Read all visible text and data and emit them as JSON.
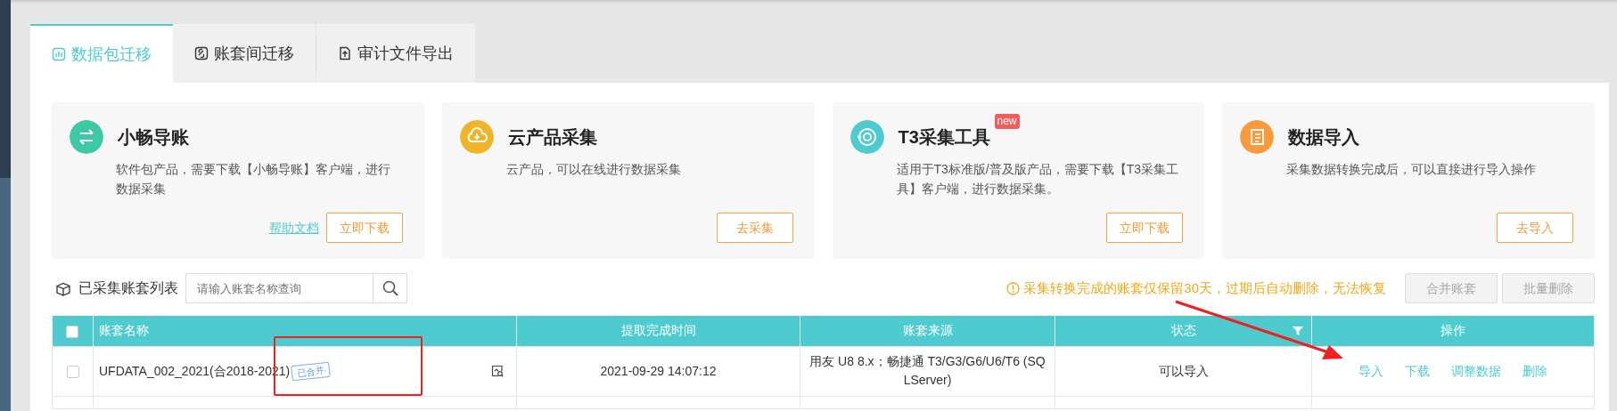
{
  "tabs": [
    {
      "label": "数据包迁移",
      "selected": true
    },
    {
      "label": "账套间迁移",
      "selected": false
    },
    {
      "label": "审计文件导出",
      "selected": false
    }
  ],
  "cards": [
    {
      "title": "小畅导账",
      "color": "#3cc9a4",
      "description": "软件包产品，需要下载【小畅导账】客户端，进行数据采集",
      "links": [
        "帮助文档"
      ],
      "buttons": [
        "立即下载"
      ]
    },
    {
      "title": "云产品采集",
      "color": "#f0b428",
      "description": "云产品，可以在线进行数据采集",
      "buttons": [
        "去采集"
      ]
    },
    {
      "title": "T3采集工具",
      "badge": "new",
      "color": "#4ecbcf",
      "description": "适用于T3标准版/普及版产品，需要下载【T3采集工具】客户端，进行数据采集。",
      "buttons": [
        "立即下载"
      ]
    },
    {
      "title": "数据导入",
      "color": "#fa9a3c",
      "description": "采集数据转换完成后，可以直接进行导入操作",
      "buttons": [
        "去导入"
      ]
    }
  ],
  "list": {
    "title": "已采集账套列表",
    "search": {
      "placeholder": "请输入账套名称查询"
    },
    "notice": "采集转换完成的账套仅保留30天，过期后自动删除，无法恢复",
    "buttons": [
      {
        "label": "合并账套",
        "disabled": true
      },
      {
        "label": "批量删除",
        "disabled": true
      }
    ]
  },
  "table": {
    "select_all": {
      "checked": false
    },
    "columns": [
      {
        "label": "账套名称"
      },
      {
        "label": "提取完成时间"
      },
      {
        "label": "账套来源"
      },
      {
        "label": "状态",
        "filter": true
      },
      {
        "label": "操作"
      }
    ],
    "rows": [
      {
        "checked": false,
        "name": "UFDATA_002_2021(合2018-2021)",
        "tag": "·已合并·",
        "time": "2021-09-29 14:07:12",
        "source": "用友 U8 8.x；畅捷通 T3/G3/G6/U6/T6 (SQLServer)",
        "status": "可以导入",
        "actions": [
          "导入",
          "下载",
          "调整数据",
          "删除"
        ]
      }
    ]
  }
}
